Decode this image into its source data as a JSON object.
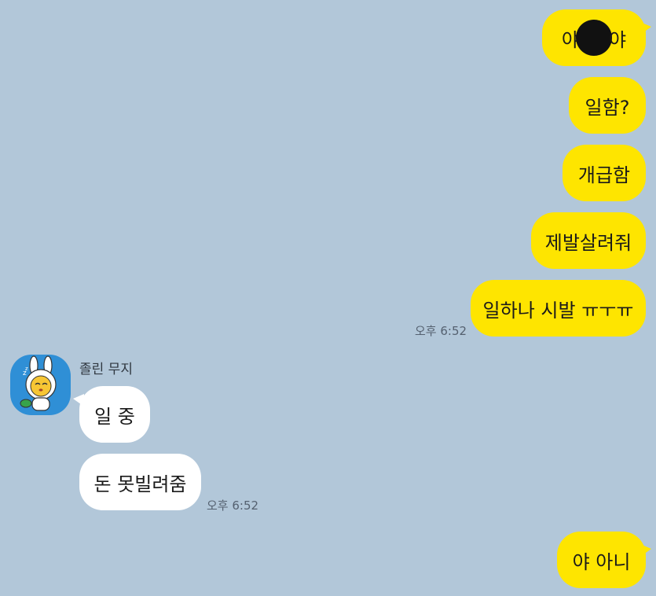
{
  "chat": {
    "sent_group_1": [
      {
        "text_a": "야",
        "text_b": "야"
      },
      {
        "text": "일함?"
      },
      {
        "text": "개급함"
      },
      {
        "text": "제발살려줘"
      },
      {
        "text": "일하나 시발 ㅠㅜㅠ"
      }
    ],
    "sent_time_1": "오후 6:52",
    "received": {
      "sender_name": "졸린 무지",
      "messages": [
        {
          "text": "일 중"
        },
        {
          "text": "돈 못빌려줌"
        }
      ],
      "time": "오후 6:52"
    },
    "sent_group_2": [
      {
        "text": "야 아니"
      }
    ]
  },
  "colors": {
    "background": "#b2c7d9",
    "sent_bubble": "#fee500",
    "received_bubble": "#ffffff"
  },
  "icons": {
    "avatar": "muzi-sleepy-avatar-icon",
    "redaction": "redaction-blot"
  }
}
